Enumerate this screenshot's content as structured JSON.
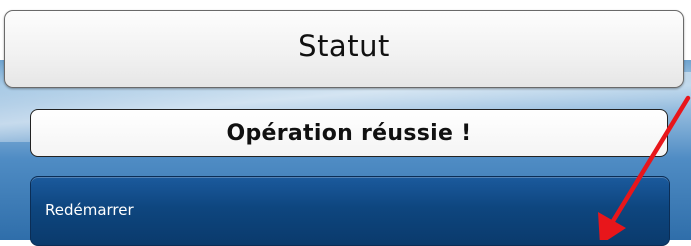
{
  "header": {
    "title": "Statut"
  },
  "status": {
    "message": "Opération réussie !"
  },
  "actions": {
    "restart_label": "Redémarrer"
  },
  "annotation": {
    "arrow_color": "#e8161b",
    "arrow_icon": "red-arrow-icon"
  },
  "colors": {
    "backdrop_blue": "#4f8cc4",
    "button_blue": "#0e467f"
  }
}
